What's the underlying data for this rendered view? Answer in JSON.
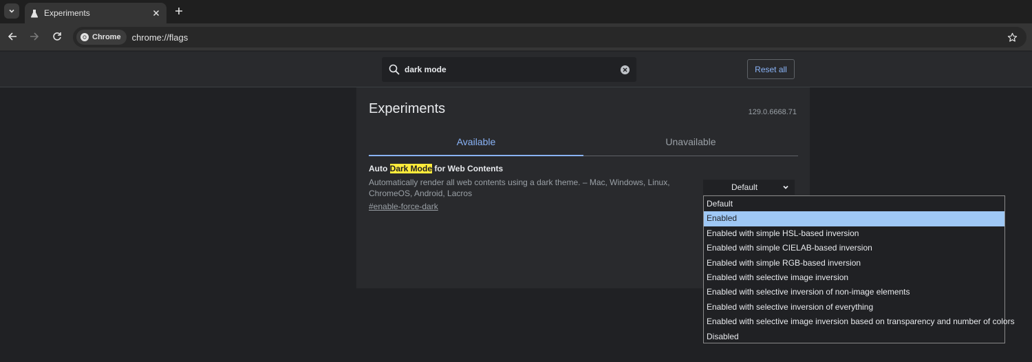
{
  "browser": {
    "tab_title": "Experiments",
    "chip_label": "Chrome",
    "url": "chrome://flags",
    "icons": {
      "tab_search": "chevron-down-icon",
      "tab_favicon": "flask-icon",
      "tab_close": "close-icon",
      "new_tab": "plus-icon",
      "back": "arrow-left-icon",
      "forward": "arrow-right-icon",
      "reload": "reload-icon",
      "chip": "chrome-icon",
      "bookmark": "star-icon"
    }
  },
  "flags_header": {
    "search_value": "dark mode",
    "reset_label": "Reset all"
  },
  "page": {
    "title": "Experiments",
    "version": "129.0.6668.71",
    "tabs": [
      {
        "label": "Available",
        "active": true
      },
      {
        "label": "Unavailable",
        "active": false
      }
    ]
  },
  "flag": {
    "title_prefix": "Auto ",
    "title_highlight": "Dark Mode",
    "title_suffix": " for Web Contents",
    "description": "Automatically render all web contents using a dark theme. – Mac, Windows, Linux, ChromeOS, Android, Lacros",
    "link": "#enable-force-dark",
    "select_value": "Default"
  },
  "dropdown": {
    "selected_index": 1,
    "options": [
      "Default",
      "Enabled",
      "Enabled with simple HSL-based inversion",
      "Enabled with simple CIELAB-based inversion",
      "Enabled with simple RGB-based inversion",
      "Enabled with selective image inversion",
      "Enabled with selective inversion of non-image elements",
      "Enabled with selective inversion of everything",
      "Enabled with selective image inversion based on transparency and number of colors",
      "Disabled"
    ]
  },
  "colors": {
    "accent": "#8ab4f8",
    "highlight": "#ffeb3b",
    "selected_option": "#9fc8f5",
    "background": "#202124",
    "panel": "#292a2d"
  }
}
